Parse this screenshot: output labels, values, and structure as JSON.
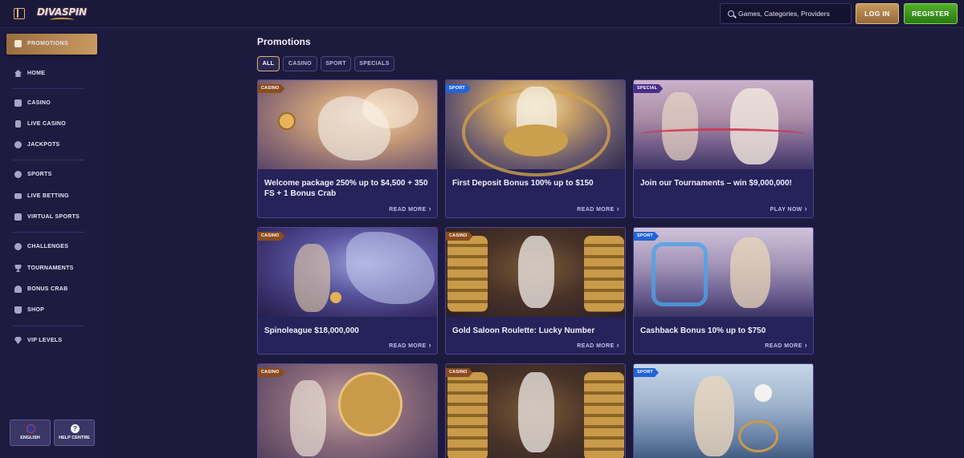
{
  "header": {
    "logo_text": "DIVASPIN",
    "search_placeholder": "Games, Categories, Providers",
    "login_label": "LOG IN",
    "register_label": "REGISTER"
  },
  "sidebar": {
    "items": [
      {
        "label": "PROMOTIONS",
        "icon": "gift-icon",
        "active": true
      },
      {
        "label": "HOME",
        "icon": "home-icon"
      },
      {
        "label": "CASINO",
        "icon": "casino-icon"
      },
      {
        "label": "LIVE CASINO",
        "icon": "live-casino-icon"
      },
      {
        "label": "JACKPOTS",
        "icon": "jackpots-icon"
      },
      {
        "label": "SPORTS",
        "icon": "sports-ball-icon"
      },
      {
        "label": "LIVE BETTING",
        "icon": "live-betting-icon"
      },
      {
        "label": "VIRTUAL SPORTS",
        "icon": "virtual-sports-icon"
      },
      {
        "label": "CHALLENGES",
        "icon": "challenges-icon"
      },
      {
        "label": "TOURNAMENTS",
        "icon": "trophy-icon"
      },
      {
        "label": "BONUS CRAB",
        "icon": "crab-icon"
      },
      {
        "label": "SHOP",
        "icon": "shop-icon"
      },
      {
        "label": "VIP LEVELS",
        "icon": "diamond-icon"
      }
    ],
    "footer": {
      "language_label": "ENGLISH",
      "help_label": "HELP CENTRE"
    }
  },
  "main": {
    "title": "Promotions",
    "filters": [
      "ALL",
      "CASINO",
      "SPORT",
      "SPECIALS"
    ],
    "active_filter": "ALL",
    "cards": [
      {
        "badge": "CASINO",
        "title": "Welcome package 250% up to $4,500 + 350 FS + 1 Bonus Crab",
        "link": "READ MORE"
      },
      {
        "badge": "SPORT",
        "title": "First Deposit Bonus 100% up to $150",
        "link": "READ MORE"
      },
      {
        "badge": "SPECIAL",
        "title": "Join our Tournaments – win $9,000,000!",
        "link": "PLAY NOW"
      },
      {
        "badge": "CASINO",
        "title": "Spinoleague $18,000,000",
        "link": "READ MORE"
      },
      {
        "badge": "CASINO",
        "title": "Gold Saloon Roulette: Lucky Number",
        "link": "READ MORE"
      },
      {
        "badge": "SPORT",
        "title": "Cashback Bonus 10% up to $750",
        "link": "READ MORE"
      },
      {
        "badge": "CASINO",
        "title": "",
        "link": ""
      },
      {
        "badge": "CASINO",
        "title": "",
        "link": ""
      },
      {
        "badge": "SPORT",
        "title": "",
        "link": ""
      }
    ]
  },
  "colors": {
    "background": "#1d1a3e",
    "accent_gold": "#c89a62",
    "register_green": "#3f961f",
    "sport_badge": "#2264d6",
    "casino_badge": "#8a4c1f"
  }
}
